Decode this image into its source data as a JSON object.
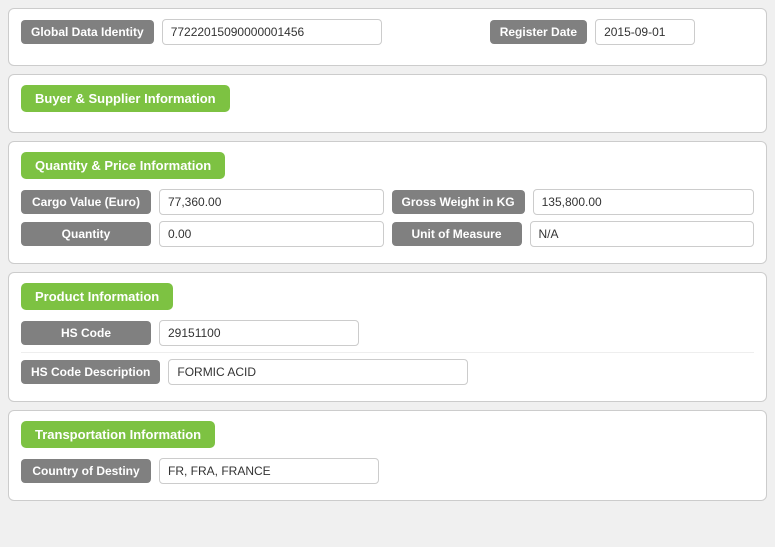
{
  "top": {
    "gdi_label": "Global Data Identity",
    "gdi_value": "77222015090000001456",
    "register_date_label": "Register Date",
    "register_date_value": "2015-09-01"
  },
  "buyer_supplier": {
    "header": "Buyer & Supplier Information"
  },
  "quantity_price": {
    "header": "Quantity & Price Information",
    "cargo_value_label": "Cargo Value (Euro)",
    "cargo_value_value": "77,360.00",
    "gross_weight_label": "Gross Weight in KG",
    "gross_weight_value": "135,800.00",
    "quantity_label": "Quantity",
    "quantity_value": "0.00",
    "unit_of_measure_label": "Unit of Measure",
    "unit_of_measure_value": "N/A"
  },
  "product": {
    "header": "Product Information",
    "hs_code_label": "HS Code",
    "hs_code_value": "29151100",
    "hs_desc_label": "HS Code Description",
    "hs_desc_value": "FORMIC ACID"
  },
  "transportation": {
    "header": "Transportation Information",
    "country_destiny_label": "Country of Destiny",
    "country_destiny_value": "FR, FRA, FRANCE"
  }
}
